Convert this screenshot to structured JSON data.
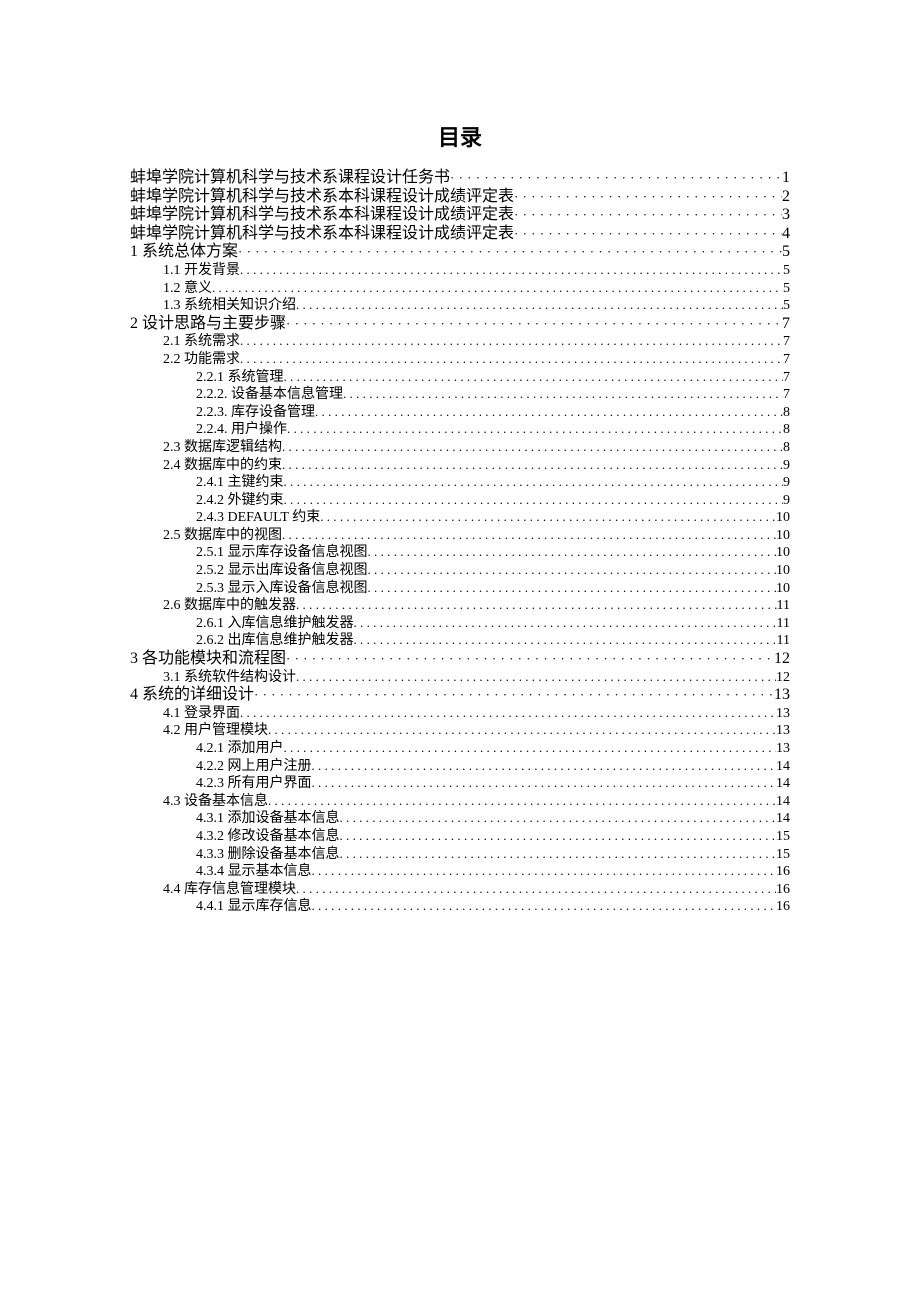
{
  "title": "目录",
  "toc": [
    {
      "level": 0,
      "label": "蚌埠学院计算机科学与技术系课程设计任务书",
      "page": "1",
      "leader": "bigdots"
    },
    {
      "level": 0,
      "label": "蚌埠学院计算机科学与技术系本科课程设计成绩评定表",
      "page": "2",
      "leader": "bigdots"
    },
    {
      "level": 0,
      "label": "蚌埠学院计算机科学与技术系本科课程设计成绩评定表",
      "page": "3",
      "leader": "bigdots"
    },
    {
      "level": 0,
      "label": "蚌埠学院计算机科学与技术系本科课程设计成绩评定表",
      "page": "4",
      "leader": "bigdots"
    },
    {
      "level": 0,
      "label": "1 系统总体方案",
      "page": "5",
      "leader": "bigdots"
    },
    {
      "level": 1,
      "label": "1.1 开发背景",
      "page": "5",
      "leader": "dots"
    },
    {
      "level": 1,
      "label": "1.2 意义",
      "page": "5",
      "leader": "dots"
    },
    {
      "level": 1,
      "label": "1.3 系统相关知识介绍",
      "page": "5",
      "leader": "dots"
    },
    {
      "level": 0,
      "label": "2   设计思路与主要步骤",
      "page": "7",
      "leader": "bigdots"
    },
    {
      "level": 1,
      "label": "2.1 系统需求",
      "page": "7",
      "leader": "dots"
    },
    {
      "level": 1,
      "label": "2.2 功能需求",
      "page": "7",
      "leader": "dots"
    },
    {
      "level": 2,
      "label": "2.2.1 系统管理",
      "page": "7",
      "leader": "dots"
    },
    {
      "level": 2,
      "label": "2.2.2. 设备基本信息管理",
      "page": "7",
      "leader": "dots"
    },
    {
      "level": 2,
      "label": "2.2.3. 库存设备管理",
      "page": "8",
      "leader": "dots"
    },
    {
      "level": 2,
      "label": "2.2.4. 用户操作",
      "page": "8",
      "leader": "dots"
    },
    {
      "level": 1,
      "label": "2.3 数据库逻辑结构",
      "page": "8",
      "leader": "dots"
    },
    {
      "level": 1,
      "label": "2.4 数据库中的约束",
      "page": "9",
      "leader": "dots"
    },
    {
      "level": 2,
      "label": "2.4.1 主键约束",
      "page": "9",
      "leader": "dots"
    },
    {
      "level": 2,
      "label": "2.4.2 外键约束",
      "page": "9",
      "leader": "dots"
    },
    {
      "level": 2,
      "label": "2.4.3 DEFAULT 约束",
      "page": "10",
      "leader": "dots"
    },
    {
      "level": 1,
      "label": "2.5 数据库中的视图",
      "page": "10",
      "leader": "dots"
    },
    {
      "level": 2,
      "label": "2.5.1 显示库存设备信息视图",
      "page": "10",
      "leader": "dots"
    },
    {
      "level": 2,
      "label": "2.5.2 显示出库设备信息视图",
      "page": "10",
      "leader": "dots"
    },
    {
      "level": 2,
      "label": "2.5.3 显示入库设备信息视图",
      "page": "10",
      "leader": "dots"
    },
    {
      "level": 1,
      "label": "2.6 数据库中的触发器",
      "page": "11",
      "leader": "dots"
    },
    {
      "level": 2,
      "label": "2.6.1 入库信息维护触发器",
      "page": "11",
      "leader": "dots"
    },
    {
      "level": 2,
      "label": "2.6.2 出库信息维护触发器",
      "page": "11",
      "leader": "dots"
    },
    {
      "level": 0,
      "label": "3 各功能模块和流程图",
      "page": "12",
      "leader": "bigdots"
    },
    {
      "level": 1,
      "label": "3.1 系统软件结构设计",
      "page": "12",
      "leader": "dots"
    },
    {
      "level": 0,
      "label": "4 系统的详细设计",
      "page": "13",
      "leader": "bigdots"
    },
    {
      "level": 1,
      "label": "4.1 登录界面",
      "page": "13",
      "leader": "dots"
    },
    {
      "level": 1,
      "label": "4.2 用户管理模块",
      "page": "13",
      "leader": "dots"
    },
    {
      "level": 2,
      "label": "4.2.1 添加用户",
      "page": "13",
      "leader": "dots"
    },
    {
      "level": 2,
      "label": "4.2.2 网上用户注册",
      "page": "14",
      "leader": "dots"
    },
    {
      "level": 2,
      "label": "4.2.3 所有用户界面",
      "page": "14",
      "leader": "dots"
    },
    {
      "level": 1,
      "label": "4.3 设备基本信息",
      "page": "14",
      "leader": "dots"
    },
    {
      "level": 2,
      "label": "4.3.1 添加设备基本信息",
      "page": "14",
      "leader": "dots"
    },
    {
      "level": 2,
      "label": "4.3.2 修改设备基本信息",
      "page": "15",
      "leader": "dots"
    },
    {
      "level": 2,
      "label": "4.3.3 删除设备基本信息",
      "page": "15",
      "leader": "dots"
    },
    {
      "level": 2,
      "label": "4.3.4 显示基本信息",
      "page": "16",
      "leader": "dots"
    },
    {
      "level": 1,
      "label": "4.4 库存信息管理模块",
      "page": "16",
      "leader": "dots"
    },
    {
      "level": 2,
      "label": "4.4.1 显示库存信息",
      "page": "16",
      "leader": "dots"
    }
  ]
}
